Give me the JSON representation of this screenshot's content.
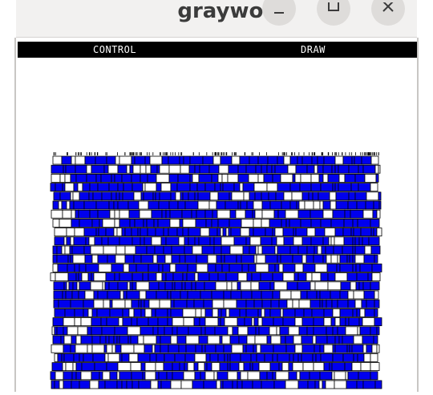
{
  "window": {
    "title": "graywolf",
    "buttons": {
      "minimize_icon": "minimize-icon",
      "maximize_icon": "maximize-icon",
      "close_icon": "close-icon"
    }
  },
  "menubar": {
    "items": [
      {
        "label": "CONTROL"
      },
      {
        "label": "DRAW"
      }
    ]
  },
  "canvas": {
    "content": "placement of standard cells",
    "colors": {
      "cell_fill": "#0000ee",
      "cell_empty": "#ffffff",
      "outline": "#000000",
      "menubar_bg": "#000000",
      "menubar_text": "#ffffff"
    }
  }
}
